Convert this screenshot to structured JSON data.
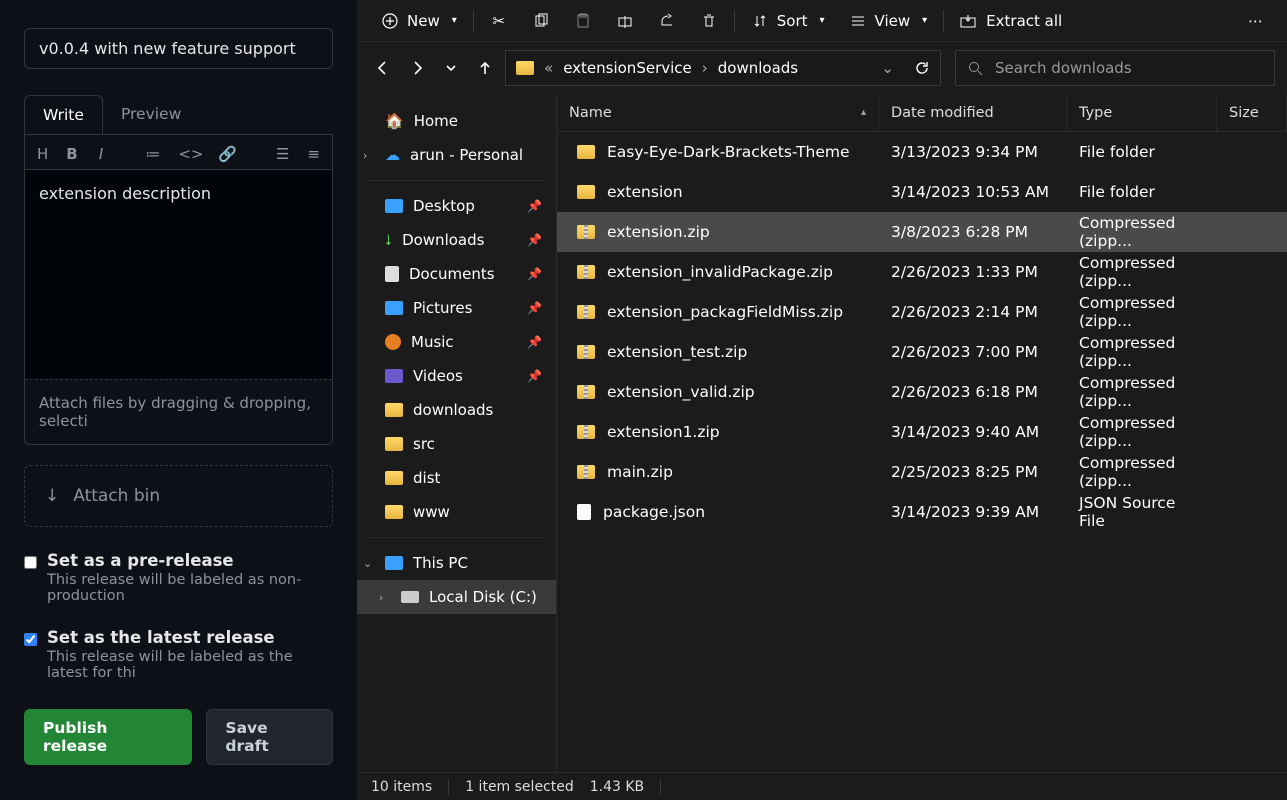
{
  "github": {
    "tag_value": "v0.0.4 with new feature support",
    "tab_write": "Write",
    "tab_preview": "Preview",
    "textarea_value": "extension description",
    "attach_note": "Attach files by dragging & dropping, selecti",
    "attach_bin": "Attach bin",
    "prerelease_title": "Set as a pre-release",
    "prerelease_sub": "This release will be labeled as non-production",
    "latest_title": "Set as the latest release",
    "latest_sub": "This release will be labeled as the latest for thi",
    "publish": "Publish release",
    "draft": "Save draft"
  },
  "toolbar": {
    "new": "New",
    "sort": "Sort",
    "view": "View",
    "extract": "Extract all"
  },
  "breadcrumb": {
    "a": "extensionService",
    "b": "downloads"
  },
  "search_placeholder": "Search downloads",
  "nav": {
    "home": "Home",
    "personal": "arun - Personal",
    "desktop": "Desktop",
    "downloads": "Downloads",
    "documents": "Documents",
    "pictures": "Pictures",
    "music": "Music",
    "videos": "Videos",
    "folder_downloads": "downloads",
    "folder_src": "src",
    "folder_dist": "dist",
    "folder_www": "www",
    "thispc": "This PC",
    "localdisk": "Local Disk (C:)"
  },
  "columns": {
    "name": "Name",
    "date": "Date modified",
    "type": "Type",
    "size": "Size"
  },
  "files": [
    {
      "icon": "folder",
      "name": "Easy-Eye-Dark-Brackets-Theme",
      "date": "3/13/2023 9:34 PM",
      "type": "File folder"
    },
    {
      "icon": "folder",
      "name": "extension",
      "date": "3/14/2023 10:53 AM",
      "type": "File folder"
    },
    {
      "icon": "zip",
      "name": "extension.zip",
      "date": "3/8/2023 6:28 PM",
      "type": "Compressed (zipp...",
      "selected": true
    },
    {
      "icon": "zip",
      "name": "extension_invalidPackage.zip",
      "date": "2/26/2023 1:33 PM",
      "type": "Compressed (zipp..."
    },
    {
      "icon": "zip",
      "name": "extension_packagFieldMiss.zip",
      "date": "2/26/2023 2:14 PM",
      "type": "Compressed (zipp..."
    },
    {
      "icon": "zip",
      "name": "extension_test.zip",
      "date": "2/26/2023 7:00 PM",
      "type": "Compressed (zipp..."
    },
    {
      "icon": "zip",
      "name": "extension_valid.zip",
      "date": "2/26/2023 6:18 PM",
      "type": "Compressed (zipp..."
    },
    {
      "icon": "zip",
      "name": "extension1.zip",
      "date": "3/14/2023 9:40 AM",
      "type": "Compressed (zipp..."
    },
    {
      "icon": "zip",
      "name": "main.zip",
      "date": "2/25/2023 8:25 PM",
      "type": "Compressed (zipp..."
    },
    {
      "icon": "file",
      "name": "package.json",
      "date": "3/14/2023 9:39 AM",
      "type": "JSON Source File"
    }
  ],
  "status": {
    "count": "10 items",
    "selected": "1 item selected",
    "size": "1.43 KB"
  }
}
